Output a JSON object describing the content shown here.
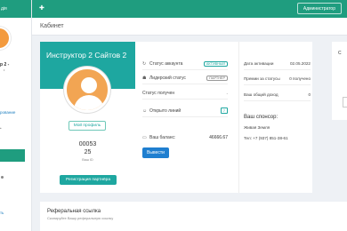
{
  "sidebar": {
    "logo_text": "дiя",
    "user_name": "р 2 -",
    "user_sub": "•",
    "items": [
      {
        "label": "рование"
      },
      {
        "label": "•"
      },
      {
        "label": "ть"
      }
    ]
  },
  "topbar": {
    "admin_label": "Администратор"
  },
  "page": {
    "title": "Кабинет"
  },
  "profile": {
    "title": "Инструктор 2 Сайтов 2",
    "my_profile_label": "Мой профиль",
    "id_line1": "00053",
    "id_line2": "25",
    "id_label": "Ваш ID",
    "register_partner_label": "Регистрация партнёра"
  },
  "stats": {
    "rows": [
      {
        "icon": "refresh-icon",
        "label": "Статус аккаунта",
        "value": "АКТИВНЫЙ"
      },
      {
        "icon": "user-icon",
        "label": "Лидерский статус",
        "value": "ПАРТНЕР"
      },
      {
        "icon": "",
        "label": "Статус получен",
        "value": "-"
      },
      {
        "icon": "users-icon",
        "label": "Открыто линий",
        "value": "7"
      }
    ],
    "balance_label": "Ваш баланс:",
    "balance_value": "46666.67",
    "withdraw_label": "Вывести"
  },
  "info": {
    "rows": [
      {
        "label": "Дата активации",
        "value": "02.05.2022"
      },
      {
        "label": "Премии за статусы",
        "value": "0 получено"
      },
      {
        "label": "Ваш общий доход",
        "value": "0"
      }
    ],
    "sponsor_title": "Ваш спонсор:",
    "sponsor_name": "Живая Земля",
    "sponsor_phone": "Тел: +7 (937) 851-38-61"
  },
  "right_card": {
    "title": "С"
  },
  "referral": {
    "title": "Реферальная ссылка",
    "subtitle": "Скопируйте Вашу реферальную ссылку"
  }
}
